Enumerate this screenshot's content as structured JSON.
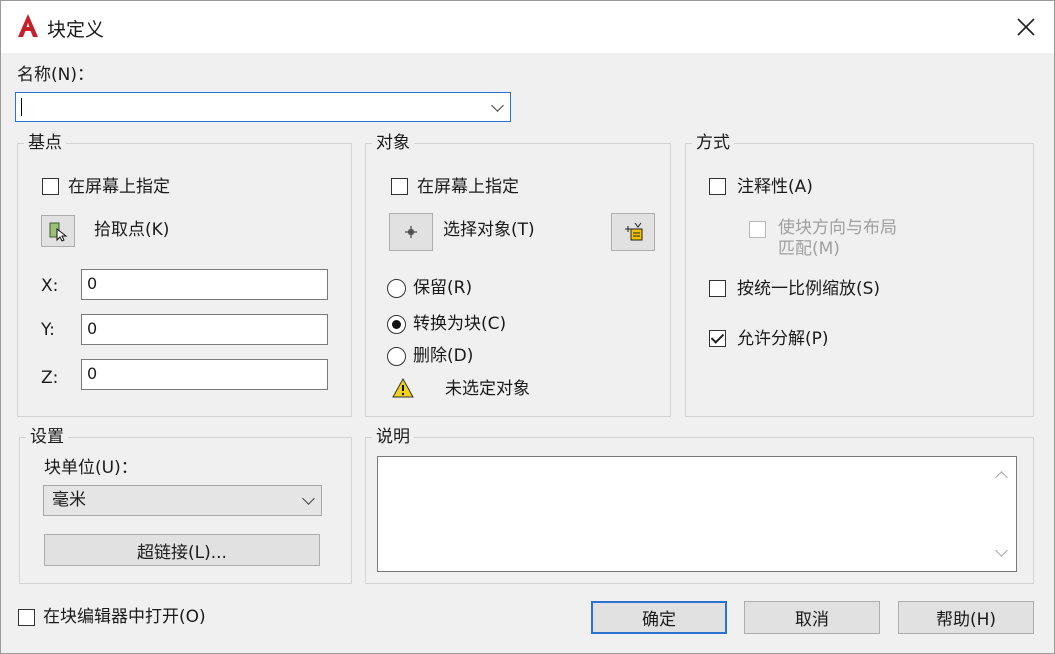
{
  "window": {
    "title": "块定义"
  },
  "name_field": {
    "label": "名称(N)：",
    "value": ""
  },
  "base_point": {
    "title": "基点",
    "specify_on_screen": "在屏幕上指定",
    "pick_point": "拾取点(K)",
    "x_label": "X:",
    "x_value": "0",
    "y_label": "Y:",
    "y_value": "0",
    "z_label": "Z:",
    "z_value": "0"
  },
  "objects": {
    "title": "对象",
    "specify_on_screen": "在屏幕上指定",
    "select_objects": "选择对象(T)",
    "retain": "保留(R)",
    "convert_to_block": "转换为块(C)",
    "delete": "删除(D)",
    "warning": "未选定对象"
  },
  "behavior": {
    "title": "方式",
    "annotative": "注释性(A)",
    "match_orientation_line1": "使块方向与布局",
    "match_orientation_line2": "匹配(M)",
    "scale_uniformly": "按统一比例缩放(S)",
    "allow_exploding": "允许分解(P)"
  },
  "settings": {
    "title": "设置",
    "block_unit_label": "块单位(U)：",
    "block_unit_value": "毫米",
    "hyperlink": "超链接(L)..."
  },
  "description": {
    "title": "说明"
  },
  "footer": {
    "open_in_editor": "在块编辑器中打开(O)",
    "ok": "确定",
    "cancel": "取消",
    "help": "帮助(H)"
  },
  "colors": {
    "accent": "#2b72d4",
    "app_icon": "#c8202a",
    "warning": "#f2d21b"
  }
}
